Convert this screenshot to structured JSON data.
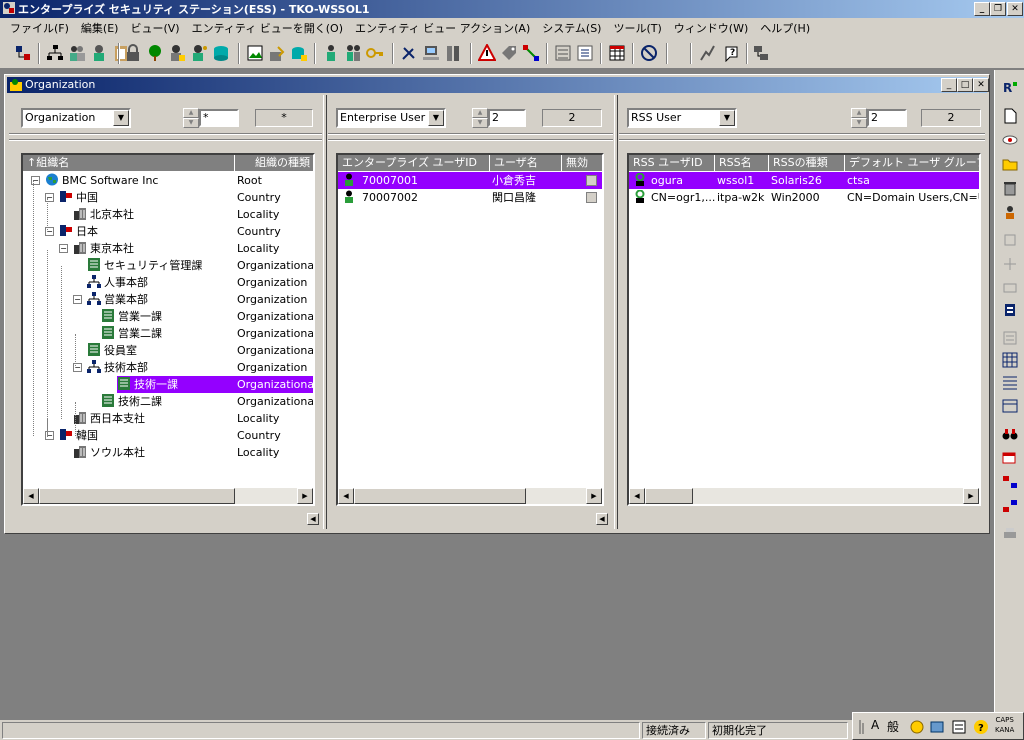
{
  "window": {
    "title": "エンタープライズ セキュリティ ステーション(ESS) - TKO-WSSOL1"
  },
  "menu": [
    "ファイル(F)",
    "編集(E)",
    "ビュー(V)",
    "エンティティ ビューを開く(O)",
    "エンティティ ビュー アクション(A)",
    "システム(S)",
    "ツール(T)",
    "ウィンドウ(W)",
    "ヘルプ(H)"
  ],
  "child_window": {
    "title": "Organization"
  },
  "panes": {
    "org": {
      "combo": "Organization",
      "spin_value": "*",
      "count": "*",
      "headers": [
        "組織名",
        "組織の種類"
      ],
      "rows": [
        {
          "name": "BMC Software Inc",
          "type": "Root"
        },
        {
          "name": "中国",
          "type": "Country"
        },
        {
          "name": "北京本社",
          "type": "Locality"
        },
        {
          "name": "日本",
          "type": "Country"
        },
        {
          "name": "東京本社",
          "type": "Locality"
        },
        {
          "name": "セキュリティ管理課",
          "type": "Organizational"
        },
        {
          "name": "人事本部",
          "type": "Organization"
        },
        {
          "name": "営業本部",
          "type": "Organization"
        },
        {
          "name": "営業一課",
          "type": "Organizational"
        },
        {
          "name": "営業二課",
          "type": "Organizational"
        },
        {
          "name": "役員室",
          "type": "Organizational"
        },
        {
          "name": "技術本部",
          "type": "Organization"
        },
        {
          "name": "技術一課",
          "type": "Organizational"
        },
        {
          "name": "技術二課",
          "type": "Organizational"
        },
        {
          "name": "西日本支社",
          "type": "Locality"
        },
        {
          "name": "韓国",
          "type": "Country"
        },
        {
          "name": "ソウル本社",
          "type": "Locality"
        }
      ],
      "selected_index": 12
    },
    "ent": {
      "combo": "Enterprise User",
      "spin_value": "2",
      "count": "2",
      "headers": [
        "エンタープライズ ユーザID",
        "ユーザ名",
        "無効"
      ],
      "rows": [
        {
          "id": "70007001",
          "name": "小倉秀吉"
        },
        {
          "id": "70007002",
          "name": "関口昌隆"
        }
      ],
      "selected_index": 0
    },
    "rss": {
      "combo": "RSS User",
      "spin_value": "2",
      "count": "2",
      "headers": [
        "RSS ユーザID",
        "RSS名",
        "RSSの種類",
        "デフォルト ユーザ グループ"
      ],
      "rows": [
        {
          "id": "ogura",
          "rss": "wssol1",
          "type": "Solaris26",
          "group": "ctsa"
        },
        {
          "id": "CN=ogr1,...",
          "rss": "itpa-w2k",
          "type": "Win2000",
          "group": "CN=Domain Users,CN=U..."
        }
      ],
      "selected_index": 0
    }
  },
  "status": {
    "connection": "接続済み",
    "init": "初期化完了",
    "caps": "CAPS",
    "kana": "KANA",
    "ime": "般"
  },
  "colors": {
    "selection": "#9400ff",
    "titlebar": "#0a246a",
    "face": "#d4d0c8",
    "workspace": "#808080"
  }
}
